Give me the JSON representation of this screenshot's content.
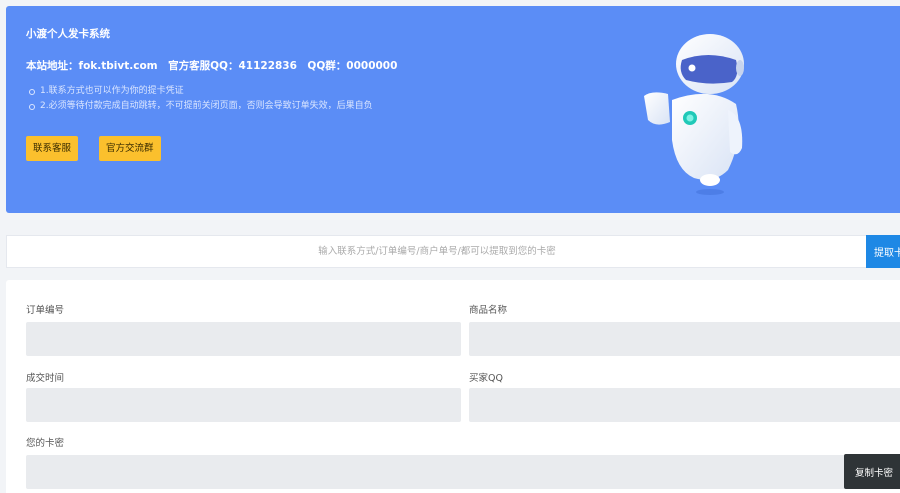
{
  "banner": {
    "title": "小渡个人发卡系统",
    "address": "本站地址：fok.tbivt.com　官方客服QQ：41122836　QQ群：0000000",
    "notes": [
      "1.联系方式也可以作为你的提卡凭证",
      "2.必须等待付款完成自动跳转，不可提前关闭页面，否则会导致订单失效，后果自负"
    ],
    "buttons": {
      "service": "联系客服",
      "group": "官方交流群"
    }
  },
  "search": {
    "placeholder": "输入联系方式/订单编号/商户单号/都可以提取到您的卡密",
    "button": "提取卡密"
  },
  "result": {
    "order_no_label": "订单编号",
    "product_label": "商品名称",
    "time_label": "成交时间",
    "buyer_qq_label": "买家QQ",
    "card_label": "您的卡密",
    "copy_button": "复制卡密"
  },
  "colors": {
    "banner": "#5b8df6",
    "accent_button": "#fbc02d",
    "search_button": "#1e88e5",
    "copy_button": "#2f3437"
  }
}
